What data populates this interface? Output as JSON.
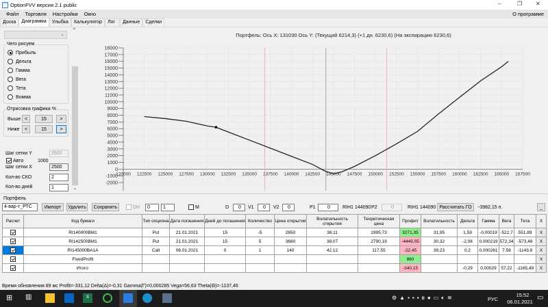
{
  "window": {
    "title": "OptionFVV версия 2.1 public",
    "min": "–",
    "max": "❐",
    "close": "✕"
  },
  "menu": {
    "items": [
      "Файл",
      "Торговля",
      "Настройки",
      "Окно"
    ],
    "about": "О программе"
  },
  "tabs": [
    "Доска",
    "Диаграмма",
    "Улыбка",
    "Калькулятор",
    "Лог",
    "Данные",
    "Сделки"
  ],
  "left": {
    "group_title": "Чего рисуем",
    "radios": [
      "Прибыль",
      "Дельта",
      "Гамма",
      "Вега",
      "Тета",
      "Вомма"
    ],
    "selected": "Прибыль",
    "range_title": "Отрисовка графика %",
    "above_label": "Выше",
    "above_value": "15",
    "below_label": "Ниже",
    "below_value": "15",
    "prev": "<",
    "next": ">",
    "grid_y_label": "Шаг сетки Y",
    "grid_y_value": "2500",
    "auto_label": "Авто",
    "auto_value": "1000",
    "grid_x_label": "Шаг сетки X",
    "grid_x_value": "2500",
    "sko_label": "Кол-во СКО",
    "sko_value": "2",
    "days_label": "Кол-во дней",
    "days_value": "1"
  },
  "chart_data": {
    "type": "line",
    "title": "Портфель: Ось X: 131030 Ось Y:  (Текущий 6214,3)  (+1 дн. 6230,6)  (На экспирацию 6230,6)",
    "xlim": [
      120000,
      167500
    ],
    "ylim": [
      -2000,
      18000
    ],
    "xticks": [
      120000,
      122500,
      125000,
      127500,
      130000,
      132500,
      135000,
      137500,
      140000,
      142500,
      145000,
      147500,
      150000,
      152500,
      155000,
      157500,
      160000,
      162500,
      165000,
      167500
    ],
    "yticks": [
      18000,
      17000,
      16000,
      15000,
      14000,
      13000,
      12000,
      11000,
      10000,
      9000,
      8000,
      7000,
      6000,
      5000,
      4000,
      3000,
      2000,
      1000,
      0,
      -1000,
      -2000
    ],
    "grid": true,
    "series": [
      {
        "name": "Прибыль",
        "x": [
          122500,
          125000,
          127500,
          130000,
          131030,
          132500,
          135000,
          137500,
          140000,
          142500,
          144000,
          145000,
          146000,
          147500,
          150000,
          152500,
          155000,
          157500,
          160000,
          162500,
          165000,
          165800
        ],
        "y": [
          7800,
          7500,
          7100,
          6400,
          6214,
          5500,
          4300,
          3100,
          1900,
          700,
          -300,
          -700,
          -400,
          400,
          2000,
          3750,
          5600,
          8200,
          10660,
          13100,
          15200,
          16000
        ]
      }
    ],
    "marker": {
      "x": 131030,
      "y": 6214
    },
    "current_price_line": 144090,
    "sigma_lines": [
      136840,
      151340
    ]
  },
  "portfolio": {
    "title": "Портфель",
    "select": "4-вар-т_РТС",
    "import": "Импорт",
    "delete": "Удалить",
    "save": "Сохранить",
    "dh": "DH",
    "spin1": "0",
    "spin2": "1",
    "m": "M",
    "d_label": "D",
    "d": "0",
    "v1_label": "V1",
    "v1": "0",
    "v2_label": "V2",
    "v2": "0",
    "p1_label": "P1",
    "p1": "0",
    "p1_sec": "RIH1 144090",
    "p2_label": "P2",
    "p2": "0",
    "p2_sec": "RIH1 144090",
    "calc": "Рассчитать ГО",
    "go": "-3982,15 п.",
    "more": "_",
    "headers": [
      "Расчет",
      "Код бумаги",
      "Тип опциона",
      "Дата погашения",
      "Дней до погашения",
      "Количество",
      "Цена открытия",
      "Волатильность открытия",
      "Теоретическая цена",
      "Профит",
      "Волатильность",
      "Дельта",
      "Гамма",
      "Вега",
      "Тета",
      "X"
    ],
    "rows": [
      {
        "code": "RI140000BM1",
        "type": "Put",
        "date": "21.01.2021",
        "days": "15",
        "qty": "-5",
        "price": "2650",
        "vol_open": "38,11",
        "theo": "1995,73",
        "profit": "3271,35",
        "vol": "31,95",
        "delta": "1,59",
        "gamma": "-0,00019",
        "vega": "-522,7",
        "theta": "551,89",
        "x": "X"
      },
      {
        "code": "RI142500BM1",
        "type": "Put",
        "date": "21.01.2021",
        "days": "15",
        "qty": "5",
        "price": "3680",
        "vol_open": "38,07",
        "theo": "2790,19",
        "profit": "-4449,05",
        "vol": "30,32",
        "delta": "-2,08",
        "gamma": "0,000219",
        "vega": "572,34",
        "theta": "-573,48",
        "x": "X"
      },
      {
        "code": "RI145000BA1A",
        "type": "Call",
        "date": "06.01.2021",
        "days": "0",
        "qty": "1",
        "price": "140",
        "vol_open": "42,12",
        "theo": "117,55",
        "profit": "-22,45",
        "vol": "39,23",
        "delta": "0,2",
        "gamma": "0,000261",
        "vega": "7,58",
        "theta": "-1143,9",
        "x": "X"
      },
      {
        "code": "FixedProfit",
        "type": "",
        "date": "",
        "days": "",
        "qty": "",
        "price": "",
        "vol_open": "",
        "theo": "",
        "profit": "860",
        "vol": "",
        "delta": "",
        "gamma": "",
        "vega": "",
        "theta": "",
        "x": "X"
      },
      {
        "code": "Итого:",
        "type": "",
        "date": "",
        "days": "",
        "qty": "",
        "price": "",
        "vol_open": "",
        "theo": "",
        "profit": "-340,15",
        "vol": "",
        "delta": "-0,29",
        "gamma": "0,00029",
        "vega": "57,22",
        "theta": "-1165,49",
        "x": "X"
      }
    ]
  },
  "status": "Время обновления 89 мс  Profit=-331,12 Delta(Δ)=-0,31 Gamma(Γ)=0,000285 Vega=56,63 Theta(Θ)=-1137,46",
  "taskbar": {
    "lang": "РУС",
    "time": "15:52",
    "date": "06.01.2021"
  }
}
